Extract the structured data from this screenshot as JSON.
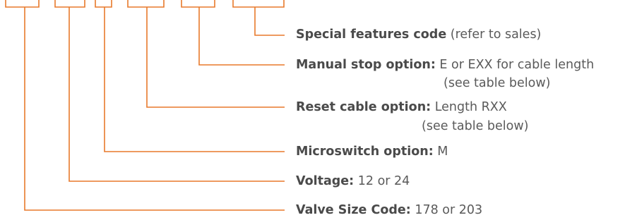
{
  "colors": {
    "line": "#e8792b",
    "label_text": "#4a4a4a",
    "body_text": "#5a5a5a"
  },
  "fields": [
    {
      "label": "Special features code",
      "text": " (refer to sales)",
      "continuation": ""
    },
    {
      "label": "Manual stop option:",
      "text": " E or EXX for cable length",
      "continuation": "(see table below)"
    },
    {
      "label": "Reset cable option:",
      "text": " Length RXX",
      "continuation": "(see table below)"
    },
    {
      "label": "Microswitch option:",
      "text": " M",
      "continuation": ""
    },
    {
      "label": "Voltage:",
      "text": " 12 or 24",
      "continuation": ""
    },
    {
      "label": "Valve Size Code:",
      "text": " 178 or 203",
      "continuation": ""
    }
  ]
}
